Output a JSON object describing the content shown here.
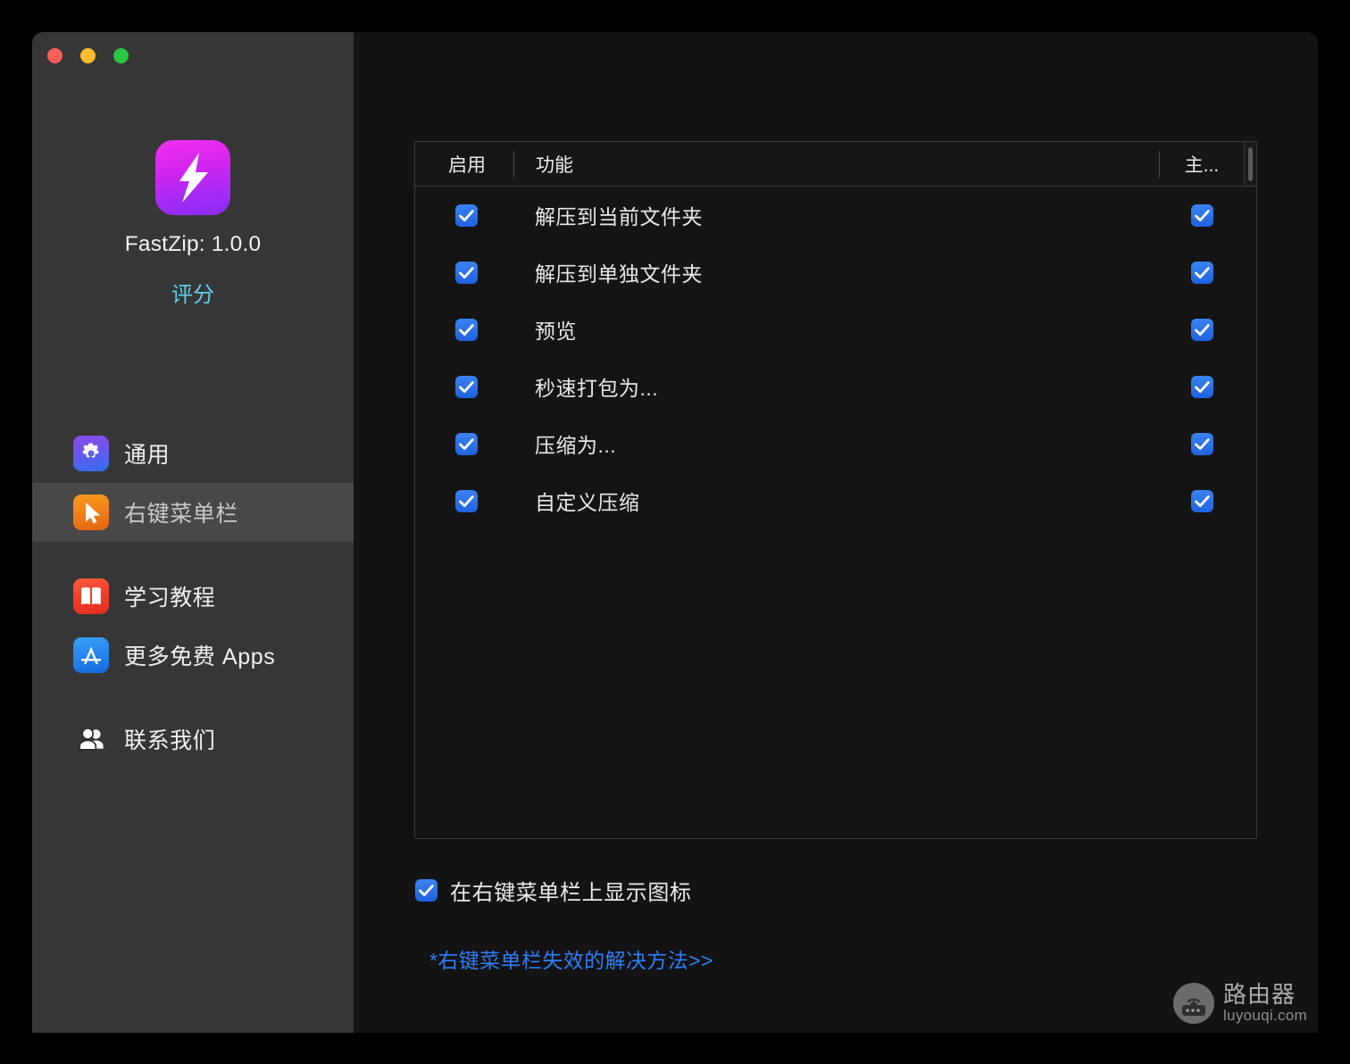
{
  "window": {
    "traffic_lights": {
      "close_color": "#ff5f57",
      "minimize_color": "#febc2e",
      "maximize_color": "#28c840"
    }
  },
  "sidebar": {
    "app_title": "FastZip: 1.0.0",
    "rate_label": "评分",
    "icon_name": "fastzip-app-icon",
    "items": [
      {
        "label": "通用",
        "icon": "gear-icon",
        "selected": false
      },
      {
        "label": "右键菜单栏",
        "icon": "cursor-arrow-icon",
        "selected": true
      },
      {
        "label": "学习教程",
        "icon": "book-icon",
        "selected": false
      },
      {
        "label": "更多免费 Apps",
        "icon": "app-store-icon",
        "selected": false
      },
      {
        "label": "联系我们",
        "icon": "people-icon",
        "selected": false
      }
    ]
  },
  "main": {
    "table": {
      "columns": {
        "enable": "启用",
        "function": "功能",
        "main": "主..."
      },
      "rows": [
        {
          "enabled": true,
          "name": "解压到当前文件夹",
          "main": true
        },
        {
          "enabled": true,
          "name": "解压到单独文件夹",
          "main": true
        },
        {
          "enabled": true,
          "name": "预览",
          "main": true
        },
        {
          "enabled": true,
          "name": "秒速打包为...",
          "main": true
        },
        {
          "enabled": true,
          "name": "压缩为...",
          "main": true
        },
        {
          "enabled": true,
          "name": "自定义压缩",
          "main": true
        }
      ]
    },
    "show_icon": {
      "label": "在右键菜单栏上显示图标",
      "checked": true
    },
    "help_link": "*右键菜单栏失效的解决方法>>"
  },
  "watermark": {
    "cn": "路由器",
    "en": "luyouqi.com",
    "icon": "router-icon"
  },
  "colors": {
    "accent_blue": "#2f7df6",
    "checkbox_blue": "#1f62e0",
    "rate_link": "#5fd0e8",
    "sidebar_bg": "#363636",
    "sidebar_selected": "#484848",
    "main_bg": "#131313"
  }
}
